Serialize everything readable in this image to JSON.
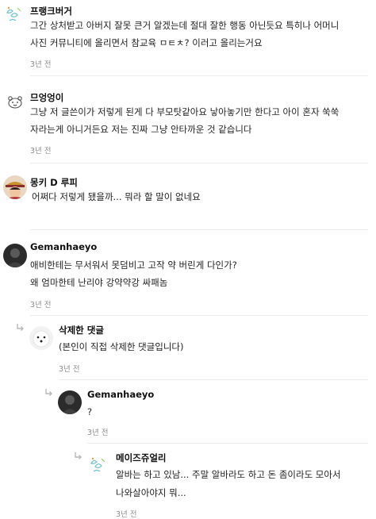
{
  "comments": [
    {
      "author": "프랭크버거",
      "lines": [
        "그간 상처받고 아버지 잘못 큰거 알겠는데 절대 잘한 행동 아닌듯요 특히나 어머니",
        "사진 커뮤니티에 올리면서 참교육 ㅁㅌㅊ? 이러고 올리는거요"
      ],
      "time": "3년 전",
      "avatar": "leaf-doodle"
    },
    {
      "author": "므엉엉이",
      "lines": [
        "그냥 저 글쓴이가 저렇게 된게 다 부모탓같아요 낳아놓기만 한다고 아이 혼자 쑥쑥",
        "자라는게 아니거든요 저는 진짜 그냥 안타까운 것 같습니다"
      ],
      "time": "3년 전",
      "avatar": "bear-doodle"
    },
    {
      "author": "몽키 D 루피",
      "lines": [
        "어쩌다 저렇게 됐을까... 뭐라 할 말이 없네요"
      ],
      "avatar": "luffy-photo"
    },
    {
      "author": "Gemanhaeyo",
      "lines": [
        "애비한테는 무서워서 못덤비고 고작 약 버린게 다인가?",
        "왜 엄마한테 난리야 강약약강 싸패놈"
      ],
      "time": "3년 전",
      "avatar": "dark-photo"
    },
    {
      "author": "삭제한 댓글",
      "lines": [
        "(본인이 직접 삭제한 댓글입니다)"
      ],
      "time": "3년 전",
      "avatar": "white-dog"
    },
    {
      "author": "Gemanhaeyo",
      "lines": [
        "?"
      ],
      "time": "3년 전",
      "avatar": "dark-photo"
    },
    {
      "author": "메이즈쥬얼리",
      "lines": [
        "알바는 하고 있남... 주말 알바라도 하고 돈 좀이라도 모아서",
        "나와살아야지 뭐..."
      ],
      "time": "3년 전",
      "avatar": "leaf-doodle"
    }
  ],
  "colors": {
    "time": "#8e8e8e",
    "divider": "#ececec",
    "reply_icon": "#b8b8b8"
  }
}
